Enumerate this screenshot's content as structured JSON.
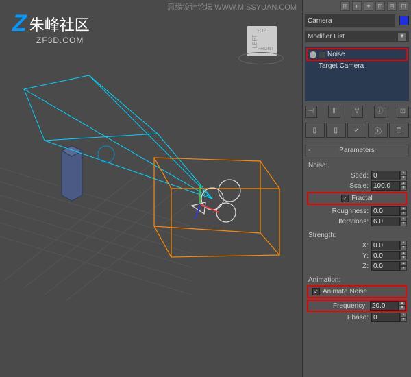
{
  "watermark": {
    "top": "思缘设计论坛  WWW.MISSYUAN.COM"
  },
  "logo": {
    "text": "朱峰社区",
    "url": "ZF3D.COM"
  },
  "viewcube": {
    "top": "TOP",
    "left": "LEFT",
    "front": "FRONT"
  },
  "panel": {
    "object_name": "Camera",
    "modifier_list_label": "Modifier List",
    "modifiers": [
      {
        "name": "Noise",
        "highlighted": true
      },
      {
        "name": "Target Camera",
        "highlighted": false
      }
    ],
    "rollout_title": "Parameters",
    "noise_group": {
      "title": "Noise:",
      "seed_label": "Seed:",
      "seed_value": "0",
      "scale_label": "Scale:",
      "scale_value": "100.0",
      "fractal_label": "Fractal",
      "roughness_label": "Roughness:",
      "roughness_value": "0.0",
      "iterations_label": "Iterations:",
      "iterations_value": "6.0"
    },
    "strength_group": {
      "title": "Strength:",
      "x_label": "X:",
      "x_value": "0.0",
      "y_label": "Y:",
      "y_value": "0.0",
      "z_label": "Z:",
      "z_value": "0.0"
    },
    "animation_group": {
      "title": "Animation:",
      "animate_noise_label": "Animate Noise",
      "frequency_label": "Frequency:",
      "frequency_value": "20.0",
      "phase_label": "Phase:",
      "phase_value": "0"
    }
  }
}
